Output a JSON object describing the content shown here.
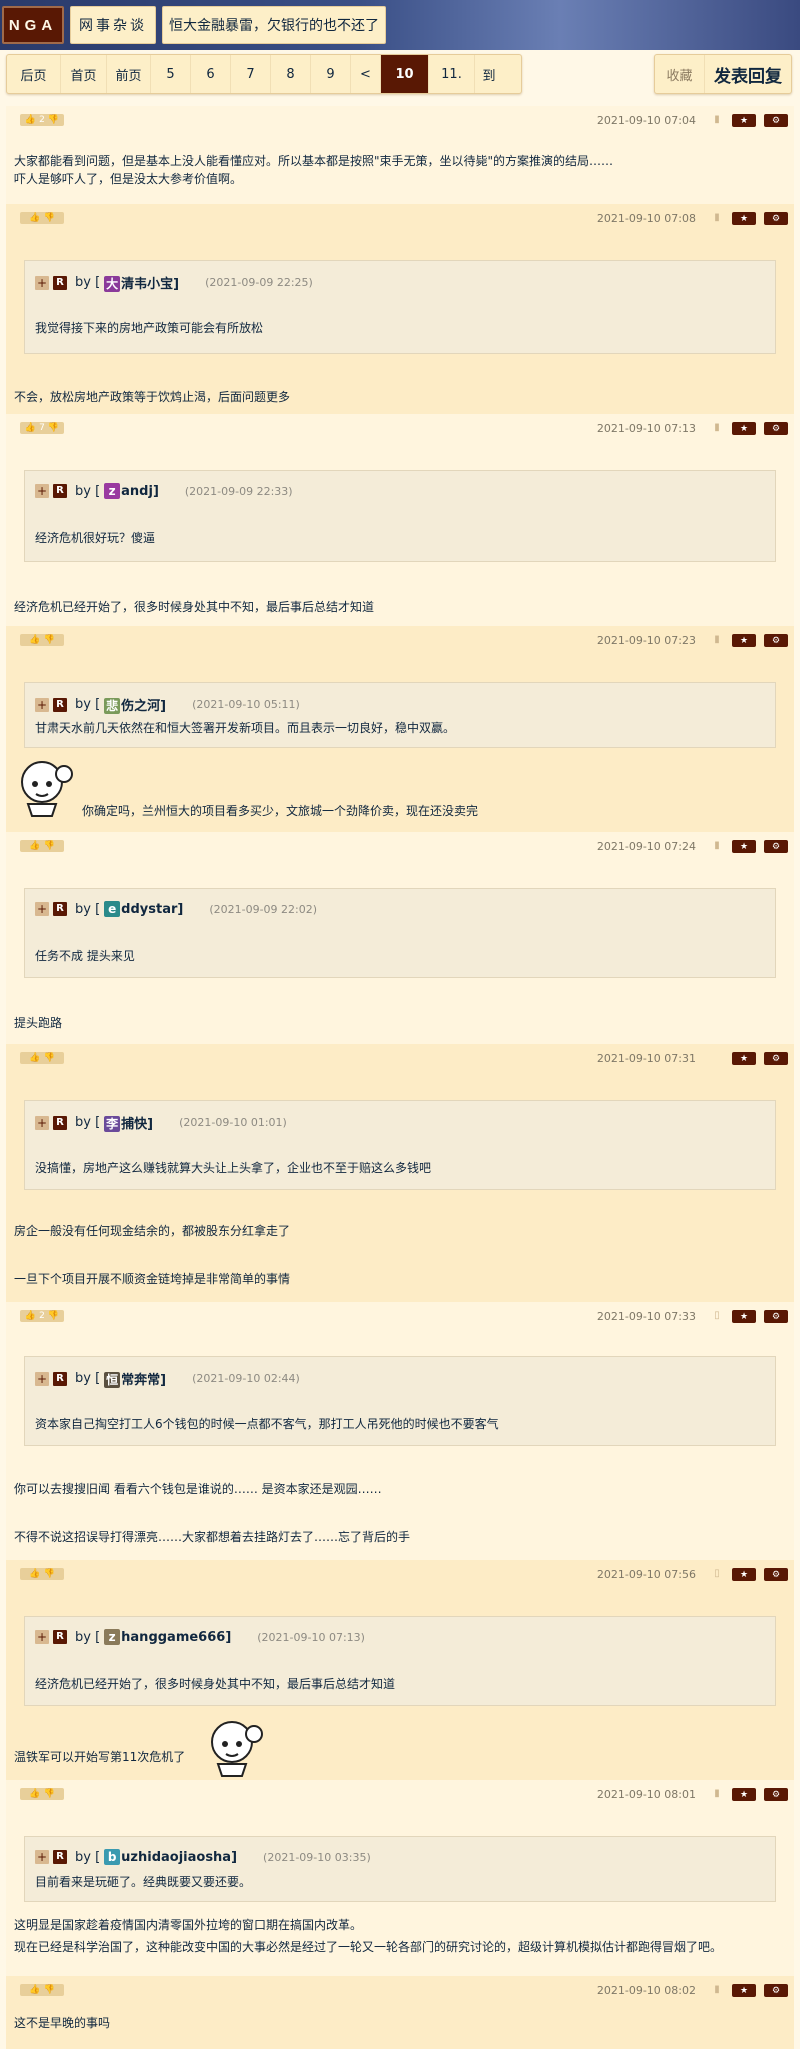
{
  "header": {
    "logo": "NGA",
    "forum": "网事杂谈",
    "thread_title": "恒大金融暴雷，欠银行的也不还了"
  },
  "pager": {
    "items": [
      "后页",
      "首页",
      "前页",
      "5",
      "6",
      "7",
      "8",
      "9",
      "<",
      "10",
      "11.",
      "到"
    ],
    "current": "10"
  },
  "actions": {
    "favorite": "收藏",
    "reply": "发表回复"
  },
  "colors": {
    "brand": "#591804",
    "post_a": "#fff5de",
    "post_b": "#fdecc6"
  },
  "posts": [
    {
      "votes": "2",
      "date": "2021-09-10 07:04",
      "body": [
        "大家都能看到问题，但是基本上没人能看懂应对。所以基本都是按照\"束手无策，坐以待毙\"的方案推演的结局……",
        "吓人是够吓人了，但是没太大参考价值啊。"
      ]
    },
    {
      "votes": "",
      "date": "2021-09-10 07:08",
      "quote": {
        "avatar": "大",
        "user": "清韦小宝]",
        "time": "(2021-09-09 22:25)",
        "text": "我觉得接下来的房地产政策可能会有所放松"
      },
      "body": [
        "不会，放松房地产政策等于饮鸩止渴，后面问题更多"
      ]
    },
    {
      "votes": "7",
      "date": "2021-09-10 07:13",
      "quote": {
        "avatar": "z",
        "user": "andj]",
        "time": "(2021-09-09 22:33)",
        "text": "经济危机很好玩？傻逼"
      },
      "body": [
        "经济危机已经开始了，很多时候身处其中不知，最后事后总结才知道"
      ]
    },
    {
      "votes": "",
      "date": "2021-09-10 07:23",
      "quote": {
        "avatar": "悲",
        "user": "伤之河]",
        "time": "(2021-09-10 05:11)",
        "text": "甘肃天水前几天依然在和恒大签署开发新项目。而且表示一切良好，稳中双赢。"
      },
      "body": [
        "你确定吗，兰州恒大的项目看多买少，文旅城一个劲降价卖，现在还没卖完"
      ]
    },
    {
      "votes": "",
      "date": "2021-09-10 07:24",
      "quote": {
        "avatar": "e",
        "user": "ddystar]",
        "time": "(2021-09-09 22:02)",
        "text": "任务不成 提头来见"
      },
      "body": [
        "提头跑路"
      ]
    },
    {
      "votes": "",
      "date": "2021-09-10 07:31",
      "quote": {
        "avatar": "李",
        "user": "捕快]",
        "time": "(2021-09-10 01:01)",
        "text": "没搞懂，房地产这么赚钱就算大头让上头拿了，企业也不至于赔这么多钱吧"
      },
      "body": [
        "房企一般没有任何现金结余的，都被股东分红拿走了",
        "一旦下个项目开展不顺资金链垮掉是非常简单的事情"
      ]
    },
    {
      "votes": "2",
      "date": "2021-09-10 07:33",
      "quote": {
        "avatar": "恒",
        "user": "常奔常]",
        "time": "(2021-09-10 02:44)",
        "text": "资本家自己掏空打工人6个钱包的时候一点都不客气，那打工人吊死他的时候也不要客气"
      },
      "body": [
        "你可以去搜搜旧闻 看看六个钱包是谁说的…… 是资本家还是观园……",
        "不得不说这招误导打得漂亮……大家都想着去挂路灯去了……忘了背后的手"
      ]
    },
    {
      "votes": "",
      "date": "2021-09-10 07:56",
      "quote": {
        "avatar": "z",
        "user": "hanggame666]",
        "time": "(2021-09-10 07:13)",
        "text": "经济危机已经开始了，很多时候身处其中不知，最后事后总结才知道"
      },
      "body": [
        "温铁军可以开始写第11次危机了"
      ]
    },
    {
      "votes": "",
      "date": "2021-09-10 08:01",
      "quote": {
        "avatar": "b",
        "user": "uzhidaojiaosha]",
        "time": "(2021-09-10 03:35)",
        "text": "目前看来是玩砸了。经典既要又要还要。"
      },
      "body": [
        "这明显是国家趁着疫情国内清零国外拉垮的窗口期在搞国内改革。",
        "现在已经是科学治国了，这种能改变中国的大事必然是经过了一轮又一轮各部门的研究讨论的，超级计算机模拟估计都跑得冒烟了吧。"
      ]
    },
    {
      "votes": "",
      "date": "2021-09-10 08:02",
      "body": [
        "这不是早晚的事吗"
      ]
    }
  ]
}
